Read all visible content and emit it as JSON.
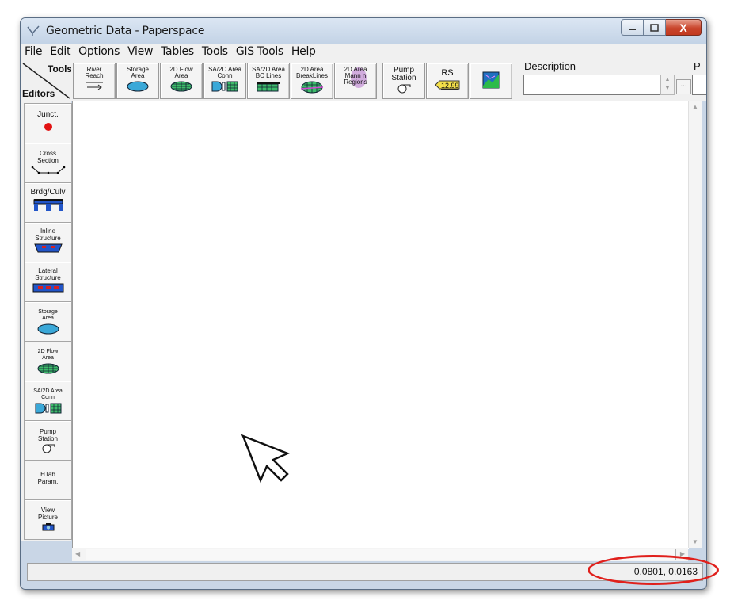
{
  "window": {
    "title": "Geometric Data - Paperspace"
  },
  "caption_buttons": {
    "minimize": "—",
    "maximize": "□",
    "close": "X"
  },
  "menu": [
    "File",
    "Edit",
    "Options",
    "View",
    "Tables",
    "Tools",
    "GIS Tools",
    "Help"
  ],
  "toolbar": {
    "tools_label": "Tools",
    "editors_label": "Editors",
    "buttons": [
      {
        "label": "River\nReach",
        "icon": "arrow-right-icon"
      },
      {
        "label": "Storage\nArea",
        "icon": "storage-area-icon"
      },
      {
        "label": "2D Flow\nArea",
        "icon": "2d-flow-area-icon"
      },
      {
        "label": "SA/2D Area\nConn",
        "icon": "sa-2d-conn-icon"
      },
      {
        "label": "SA/2D Area\nBC Lines",
        "icon": "bc-lines-icon"
      },
      {
        "label": "2D Area\nBreakLines",
        "icon": "breaklines-icon"
      },
      {
        "label": "2D Area\nMann n\nRegions",
        "icon": "mannings-regions-icon"
      },
      {
        "label": "Pump\nStation",
        "icon": "pump-icon"
      },
      {
        "label": "RS",
        "icon": "river-station-tag-icon",
        "tag_value": "12.99"
      },
      {
        "label": "",
        "icon": "map-picture-icon"
      }
    ],
    "description_label": "Description",
    "description_value": "",
    "p_label": "P",
    "more_button": "..."
  },
  "editors": [
    {
      "label": "Junct.",
      "icon": "junction-dot-icon"
    },
    {
      "label": "Cross\nSection",
      "icon": "cross-section-icon"
    },
    {
      "label": "Brdg/Culv",
      "icon": "bridge-culvert-icon"
    },
    {
      "label": "Inline\nStructure",
      "icon": "inline-structure-icon"
    },
    {
      "label": "Lateral\nStructure",
      "icon": "lateral-structure-icon"
    },
    {
      "label": "Storage\nArea",
      "icon": "storage-area-icon"
    },
    {
      "label": "2D Flow\nArea",
      "icon": "2d-flow-area-icon"
    },
    {
      "label": "SA/2D Area\nConn",
      "icon": "sa-2d-conn-icon"
    },
    {
      "label": "Pump\nStation",
      "icon": "pump-icon"
    },
    {
      "label": "HTab\nParam.",
      "icon": ""
    },
    {
      "label": "View\nPicture",
      "icon": "camera-icon"
    }
  ],
  "status": {
    "coordinates": "0.0801, 0.0163"
  },
  "colors": {
    "highlight": "#e0201c",
    "title_bar": "#c9d6e6",
    "close_button": "#c9452c"
  }
}
